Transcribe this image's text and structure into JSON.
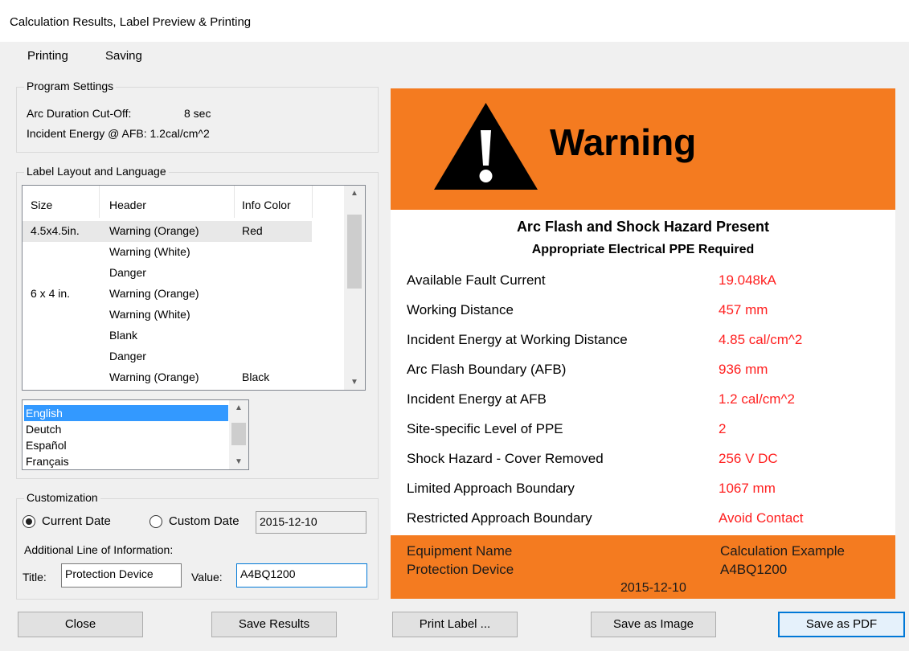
{
  "window": {
    "title": "Calculation Results, Label Preview & Printing"
  },
  "menu": {
    "printing": "Printing",
    "saving": "Saving"
  },
  "program_settings": {
    "legend": "Program Settings",
    "arc_duration_label": "Arc Duration Cut-Off:",
    "arc_duration_value": "8 sec",
    "incident_energy_text": "Incident Energy @ AFB: 1.2cal/cm^2"
  },
  "label_layout": {
    "legend": "Label Layout and Language",
    "columns": {
      "size": "Size",
      "header": "Header",
      "info_color": "Info Color"
    },
    "rows": [
      {
        "size": "4.5x4.5in.",
        "header": "Warning (Orange)",
        "info_color": "Red"
      },
      {
        "size": "",
        "header": "Warning (White)",
        "info_color": ""
      },
      {
        "size": "",
        "header": "Danger",
        "info_color": ""
      },
      {
        "size": "6 x 4 in.",
        "header": "Warning (Orange)",
        "info_color": ""
      },
      {
        "size": "",
        "header": "Warning (White)",
        "info_color": ""
      },
      {
        "size": "",
        "header": "Blank",
        "info_color": ""
      },
      {
        "size": "",
        "header": "Danger",
        "info_color": ""
      },
      {
        "size": "",
        "header": "Warning (Orange)",
        "info_color": "Black"
      }
    ],
    "languages": [
      "English",
      "Deutch",
      "Español",
      "Français"
    ],
    "selected_language": "English"
  },
  "customization": {
    "legend": "Customization",
    "current_date_label": "Current Date",
    "custom_date_label": "Custom Date",
    "custom_date_value": "2015-12-10",
    "current_date_selected": true,
    "additional_line_label": "Additional Line of Information:",
    "title_label": "Title:",
    "title_value": "Protection Device",
    "value_label": "Value:",
    "value_value": "A4BQ1200"
  },
  "buttons": {
    "close": "Close",
    "save_results": "Save Results",
    "print_label": "Print Label ...",
    "save_as_image": "Save as Image",
    "save_as_pdf": "Save as PDF"
  },
  "label_preview": {
    "header_text": "Warning",
    "hazard_line1": "Arc Flash and Shock Hazard Present",
    "hazard_line2": "Appropriate Electrical PPE Required",
    "rows": [
      {
        "label": "Available Fault Current",
        "value": "19.048kA"
      },
      {
        "label": "Working Distance",
        "value": "457 mm"
      },
      {
        "label": "Incident Energy at Working Distance",
        "value": "4.85 cal/cm^2"
      },
      {
        "label": "Arc Flash Boundary (AFB)",
        "value": "936 mm"
      },
      {
        "label": "Incident Energy at AFB",
        "value": "1.2 cal/cm^2"
      },
      {
        "label": "Site-specific Level of PPE",
        "value": "2"
      },
      {
        "label": "Shock Hazard - Cover Removed",
        "value": "256 V DC"
      },
      {
        "label": "Limited Approach Boundary",
        "value": "1067 mm"
      },
      {
        "label": "Restricted Approach Boundary",
        "value": "Avoid Contact"
      }
    ],
    "footer": {
      "equipment_label": "Equipment Name",
      "equipment_value": "Calculation Example",
      "protection_label": "Protection Device",
      "protection_value": "A4BQ1200",
      "date": "2015-12-10"
    },
    "colors": {
      "header_bg": "#f47b20",
      "value_text": "#ff2020"
    }
  }
}
